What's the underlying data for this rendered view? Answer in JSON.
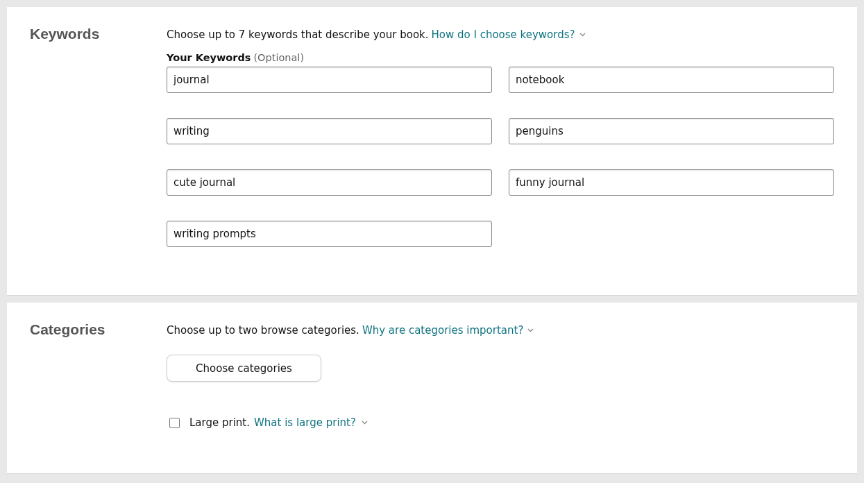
{
  "keywords": {
    "title": "Keywords",
    "description": "Choose up to 7 keywords that describe your book.",
    "help_link": "How do I choose keywords?",
    "field_label": "Your Keywords",
    "field_hint": "(Optional)",
    "values": [
      "journal",
      "notebook",
      "writing",
      "penguins",
      "cute journal",
      "funny journal",
      "writing prompts"
    ]
  },
  "categories": {
    "title": "Categories",
    "description": "Choose up to two browse categories.",
    "help_link": "Why are categories important?",
    "button": "Choose categories",
    "large_print": {
      "label": "Large print.",
      "checked": false,
      "help_link": "What is large print?"
    }
  }
}
